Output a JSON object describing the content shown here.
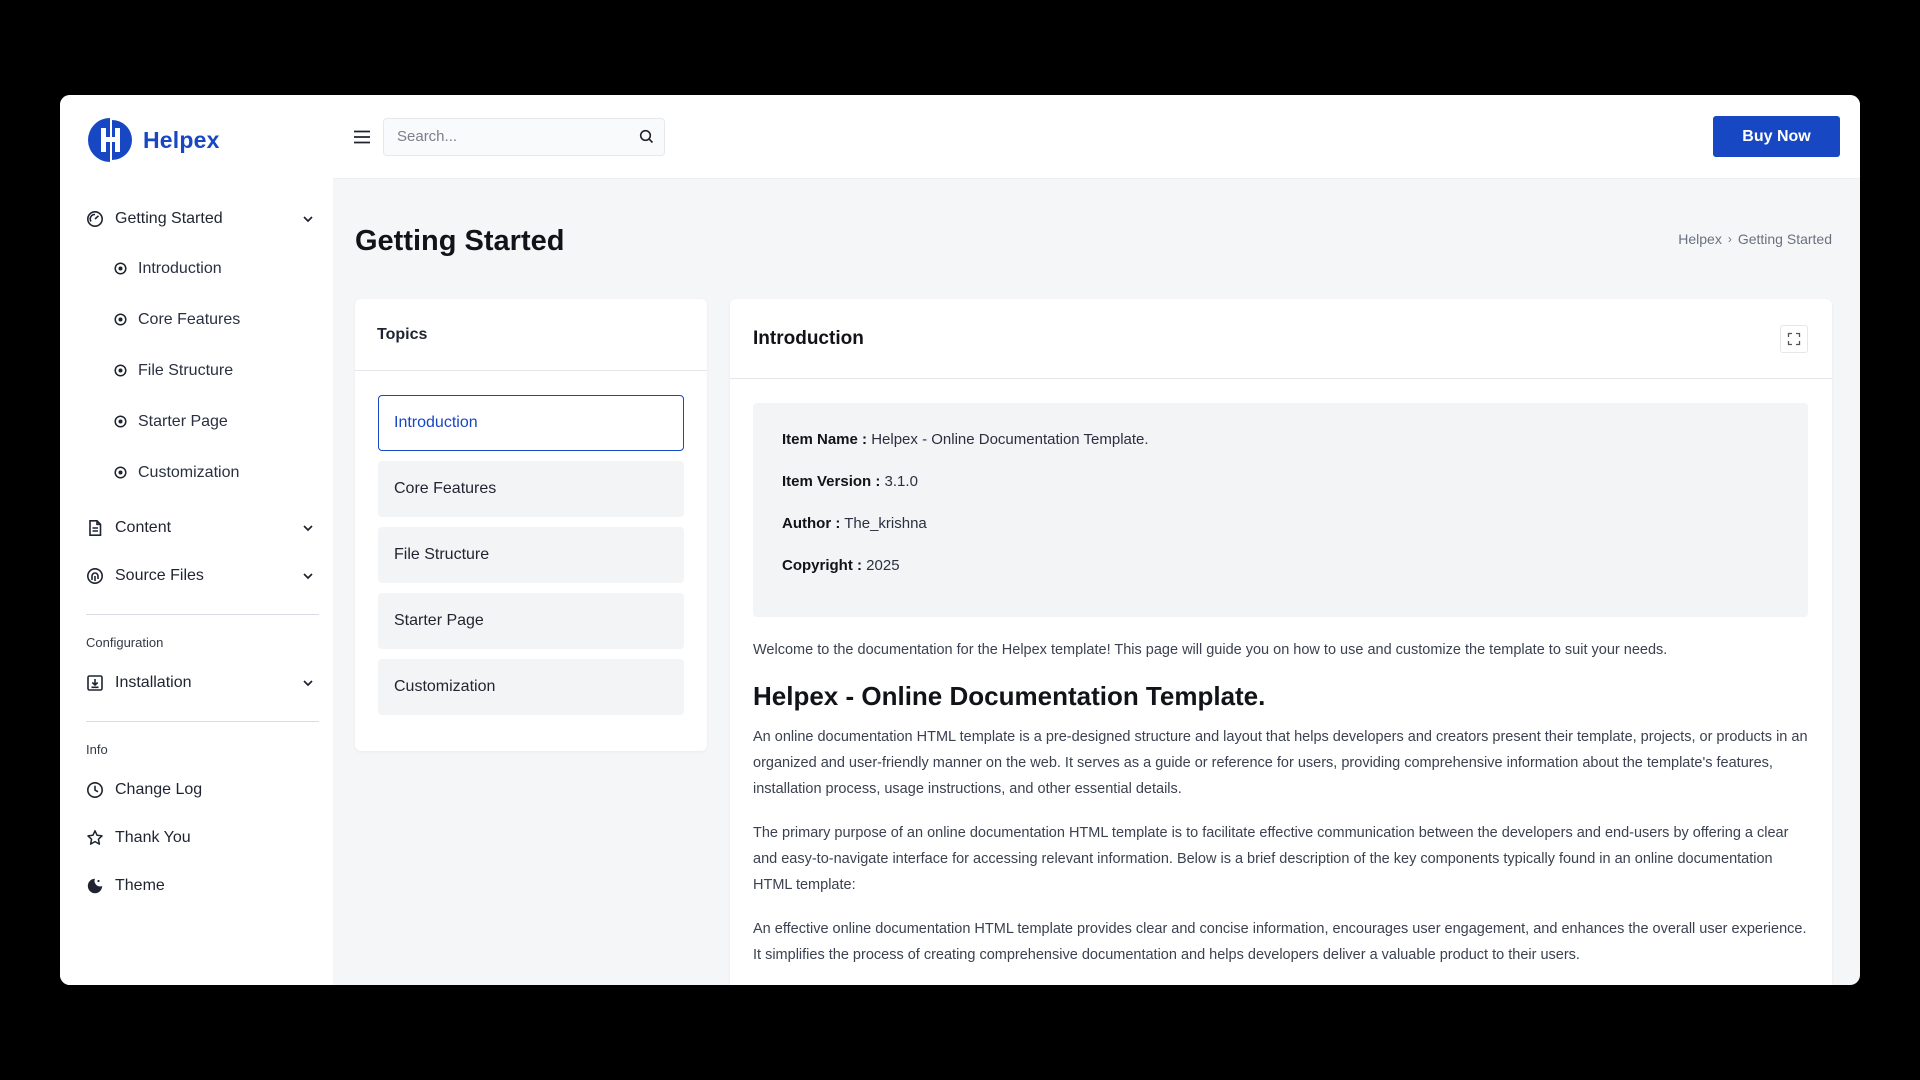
{
  "brand": {
    "name": "Helpex",
    "color": "#1747c2"
  },
  "sidebar": {
    "groups": [
      {
        "label": "Getting Started",
        "icon": "gauge-icon",
        "expanded": true,
        "children": [
          "Introduction",
          "Core Features",
          "File Structure",
          "Starter Page",
          "Customization"
        ]
      },
      {
        "label": "Content",
        "icon": "document-icon"
      },
      {
        "label": "Source Files",
        "icon": "fingerprint-icon"
      }
    ],
    "sections": [
      {
        "title": "Configuration",
        "items": [
          {
            "label": "Installation",
            "icon": "download-box-icon",
            "has_children": true
          }
        ]
      },
      {
        "title": "Info",
        "items": [
          {
            "label": "Change Log",
            "icon": "clock-icon"
          },
          {
            "label": "Thank You",
            "icon": "star-icon"
          },
          {
            "label": "Theme",
            "icon": "moon-icon"
          }
        ]
      }
    ]
  },
  "topbar": {
    "search_placeholder": "Search...",
    "buy_label": "Buy Now"
  },
  "page": {
    "title": "Getting Started",
    "breadcrumb": [
      "Helpex",
      "Getting Started"
    ]
  },
  "topics": {
    "title": "Topics",
    "items": [
      "Introduction",
      "Core Features",
      "File Structure",
      "Starter Page",
      "Customization"
    ],
    "active_index": 0
  },
  "intro": {
    "title": "Introduction",
    "info": [
      {
        "label": "Item Name :",
        "value": "Helpex - Online Documentation Template."
      },
      {
        "label": "Item Version :",
        "value": "3.1.0"
      },
      {
        "label": "Author :",
        "value": "The_krishna"
      },
      {
        "label": "Copyright :",
        "value": "2025"
      }
    ],
    "welcome": "Welcome to the documentation for the Helpex template! This page will guide you on how to use and customize the template to suit your needs.",
    "heading": "Helpex - Online Documentation Template.",
    "paragraphs": [
      "An online documentation HTML template is a pre-designed structure and layout that helps developers and creators present their template, projects, or products in an organized and user-friendly manner on the web. It serves as a guide or reference for users, providing comprehensive information about the template's features, installation process, usage instructions, and other essential details.",
      "The primary purpose of an online documentation HTML template is to facilitate effective communication between the developers and end-users by offering a clear and easy-to-navigate interface for accessing relevant information. Below is a brief description of the key components typically found in an online documentation HTML template:",
      "An effective online documentation HTML template provides clear and concise information, encourages user engagement, and enhances the overall user experience. It simplifies the process of creating comprehensive documentation and helps developers deliver a valuable product to their users."
    ]
  }
}
